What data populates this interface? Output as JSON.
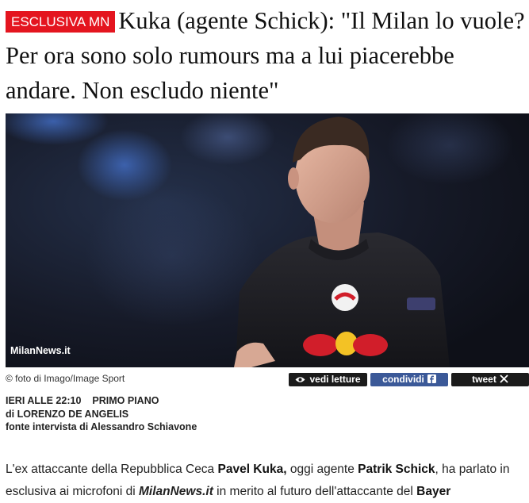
{
  "article": {
    "badge": "ESCLUSIVA MN",
    "title": "Kuka (agente Schick): \"Il Milan lo vuole? Per ora sono solo rumours ma a lui piacerebbe andare. Non escludo niente\"",
    "image": {
      "watermark": "MilanNews.it",
      "credit": "© foto di Imago/Image Sport"
    },
    "actions": {
      "views_label": "vedi letture",
      "share_label": "condividi",
      "tweet_label": "tweet"
    },
    "meta": {
      "date": "IERI ALLE 22:10",
      "section": "PRIMO PIANO",
      "author": "di LORENZO DE ANGELIS",
      "source": "fonte intervista di Alessandro Schiavone"
    },
    "body": {
      "t1": "L'ex attaccante della Repubblica Ceca ",
      "b1": "Pavel Kuka,",
      "t2": " oggi agente ",
      "b2": "Patrik Schick",
      "t3": ", ha parlato in esclusiva ai microfoni di ",
      "site": "MilanNews.it",
      "t4": " in merito al futuro dell'attaccante del ",
      "b3": "Bayer"
    }
  },
  "colors": {
    "badge_red": "#e4151f",
    "share_blue": "#3b5998",
    "button_dark": "#1b1b1b"
  },
  "icons": [
    "eye-icon",
    "facebook-icon",
    "x-logo-icon"
  ]
}
